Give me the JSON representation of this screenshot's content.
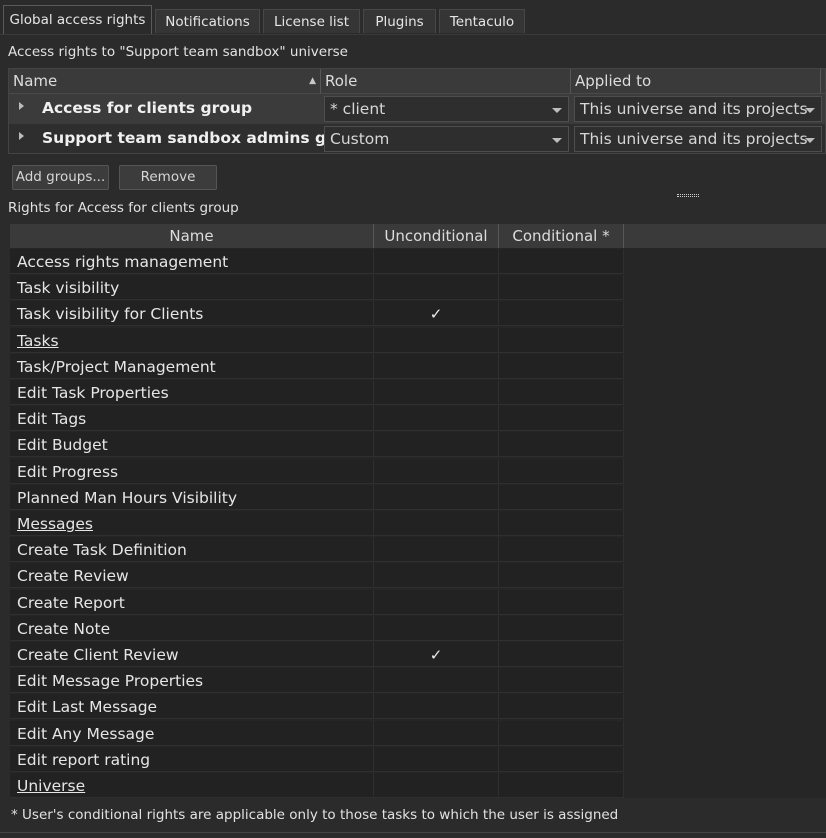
{
  "tabs": [
    {
      "label": "Global access rights",
      "active": true
    },
    {
      "label": "Notifications",
      "active": false
    },
    {
      "label": "License list",
      "active": false
    },
    {
      "label": "Plugins",
      "active": false
    },
    {
      "label": "Tentaculo",
      "active": false
    }
  ],
  "access_caption": "Access rights to \"Support team sandbox\" universe",
  "groups_grid": {
    "columns": {
      "name": "Name",
      "role": "Role",
      "applied_to": "Applied to"
    },
    "rows": [
      {
        "name": "Access for clients group",
        "role": "* client",
        "applied_to": "This universe and its projects",
        "selected": true
      },
      {
        "name": "Support team sandbox admins group",
        "role": "Custom",
        "applied_to": "This universe and its projects",
        "selected": false
      }
    ]
  },
  "buttons": {
    "add_groups": "Add groups...",
    "remove": "Remove"
  },
  "rights_caption": "Rights for  Access for clients group",
  "rights_table": {
    "columns": {
      "name": "Name",
      "unconditional": "Unconditional",
      "conditional": "Conditional *"
    },
    "check_glyph": "✓",
    "rows": [
      {
        "name": "Access rights management",
        "category": false,
        "unconditional": false,
        "conditional": false
      },
      {
        "name": "Task visibility",
        "category": false,
        "unconditional": false,
        "conditional": false
      },
      {
        "name": "Task visibility for Clients",
        "category": false,
        "unconditional": true,
        "conditional": false
      },
      {
        "name": "Tasks",
        "category": true,
        "unconditional": false,
        "conditional": false
      },
      {
        "name": "Task/Project Management",
        "category": false,
        "unconditional": false,
        "conditional": false
      },
      {
        "name": "Edit Task Properties",
        "category": false,
        "unconditional": false,
        "conditional": false
      },
      {
        "name": "Edit Tags",
        "category": false,
        "unconditional": false,
        "conditional": false
      },
      {
        "name": "Edit Budget",
        "category": false,
        "unconditional": false,
        "conditional": false
      },
      {
        "name": "Edit Progress",
        "category": false,
        "unconditional": false,
        "conditional": false
      },
      {
        "name": "Planned Man Hours Visibility",
        "category": false,
        "unconditional": false,
        "conditional": false
      },
      {
        "name": "Messages",
        "category": true,
        "unconditional": false,
        "conditional": false
      },
      {
        "name": "Create Task Definition",
        "category": false,
        "unconditional": false,
        "conditional": false
      },
      {
        "name": "Create Review",
        "category": false,
        "unconditional": false,
        "conditional": false
      },
      {
        "name": "Create Report",
        "category": false,
        "unconditional": false,
        "conditional": false
      },
      {
        "name": "Create Note",
        "category": false,
        "unconditional": false,
        "conditional": false
      },
      {
        "name": "Create Client Review",
        "category": false,
        "unconditional": true,
        "conditional": false
      },
      {
        "name": "Edit Message Properties",
        "category": false,
        "unconditional": false,
        "conditional": false
      },
      {
        "name": "Edit Last Message",
        "category": false,
        "unconditional": false,
        "conditional": false
      },
      {
        "name": "Edit Any Message",
        "category": false,
        "unconditional": false,
        "conditional": false
      },
      {
        "name": "Edit report rating",
        "category": false,
        "unconditional": false,
        "conditional": false
      },
      {
        "name": "Universe",
        "category": true,
        "unconditional": false,
        "conditional": false
      }
    ]
  },
  "footnote": "* User's conditional rights are applicable only to those tasks to which the user is assigned"
}
